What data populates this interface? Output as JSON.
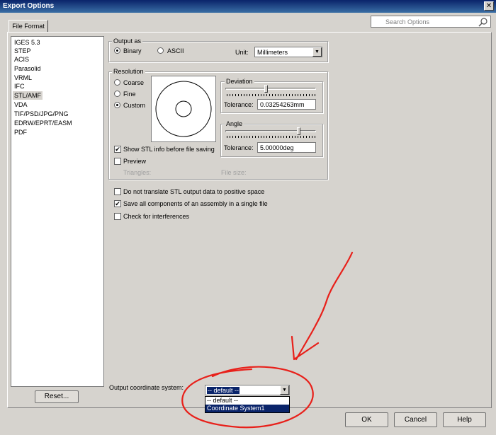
{
  "window": {
    "title": "Export Options",
    "close_glyph": "✕"
  },
  "search": {
    "placeholder": "Search Options",
    "icon": "magnifier-icon"
  },
  "tab": {
    "label": "File Format"
  },
  "formats": [
    "IGES 5.3",
    "STEP",
    "ACIS",
    "Parasolid",
    "VRML",
    "IFC",
    "STL/AMF",
    "VDA",
    "TIF/PSD/JPG/PNG",
    "EDRW/EPRT/EASM",
    "PDF"
  ],
  "selected_format": "STL/AMF",
  "reset_label": "Reset...",
  "output_as": {
    "label": "Output as",
    "binary": "Binary",
    "ascii": "ASCII",
    "selected": "Binary",
    "unit_label": "Unit:",
    "unit_value": "Millimeters"
  },
  "resolution": {
    "label": "Resolution",
    "coarse": "Coarse",
    "fine": "Fine",
    "custom": "Custom",
    "selected": "Custom",
    "deviation": {
      "label": "Deviation",
      "tolerance_label": "Tolerance:",
      "tolerance_value": "0.03254263mm",
      "slider_fraction": 0.45
    },
    "angle": {
      "label": "Angle",
      "tolerance_label": "Tolerance:",
      "tolerance_value": "5.00000deg",
      "slider_fraction": 0.82
    },
    "show_info": {
      "label": "Show STL info before file saving",
      "checked": true
    },
    "preview": {
      "label": "Preview",
      "checked": false
    },
    "triangles_label": "Triangles:",
    "file_size_label": "File size:"
  },
  "options": [
    {
      "label": "Do not translate STL output data to positive space",
      "checked": false
    },
    {
      "label": "Save all components of an assembly in a single file",
      "checked": true
    },
    {
      "label": "Check for interferences",
      "checked": false
    }
  ],
  "coordinate": {
    "label": "Output coordinate system:",
    "value": "-- default --",
    "options": [
      "-- default --",
      "Coordinate System1"
    ],
    "highlighted": "Coordinate System1"
  },
  "buttons": {
    "ok": "OK",
    "cancel": "Cancel",
    "help": "Help"
  },
  "check_glyph": "✔",
  "annotation_color": "#e8201a"
}
